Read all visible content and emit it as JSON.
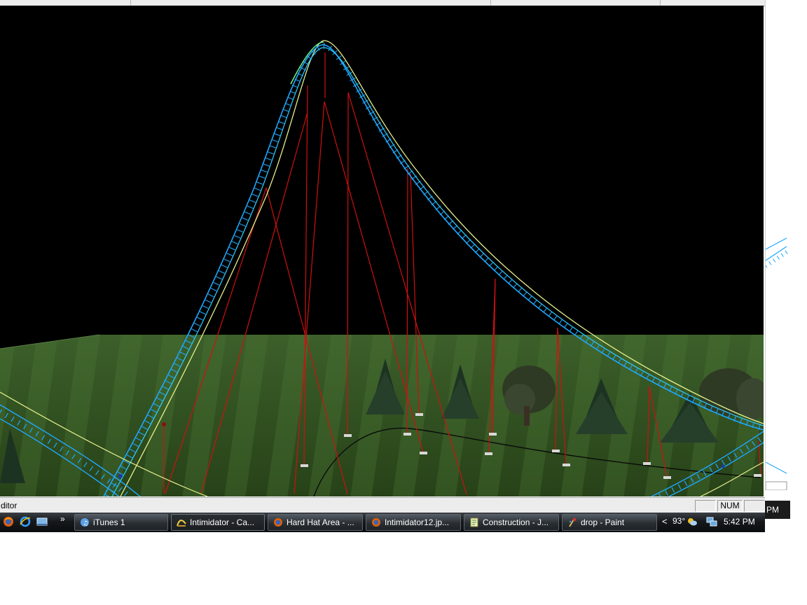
{
  "statusbar": {
    "text": "ditor",
    "num_indicator": "NUM",
    "cut_off_time_fragment": "PM"
  },
  "taskbar": {
    "overflow_chevron": "»",
    "buttons": [
      {
        "label": "iTunes 1",
        "icon": "itunes-icon",
        "active": false
      },
      {
        "label": "Intimidator - Ca...",
        "icon": "coaster-icon",
        "active": true
      },
      {
        "label": "Hard Hat Area - ...",
        "icon": "firefox-icon",
        "active": false
      },
      {
        "label": "Intimidator12.jp...",
        "icon": "firefox-icon",
        "active": false
      },
      {
        "label": "Construction - J...",
        "icon": "document-icon",
        "active": false
      },
      {
        "label": "drop - Paint",
        "icon": "paint-icon",
        "active": false
      }
    ],
    "quicklaunch": [
      "firefox-icon",
      "internet-explorer-icon",
      "show-desktop-icon"
    ],
    "tray": {
      "chevron": "<",
      "temperature": "93°",
      "weather_icon": "weather-icon",
      "network_icon": "network-icon",
      "clock": "5:42 PM"
    }
  },
  "scene": {
    "description_icon": "3d-viewport",
    "colors": {
      "sky": "#000000",
      "grass_dark": "#2c4a1c",
      "grass_light": "#4d7636",
      "track_cyan": "#1ea8ff",
      "track_yellow": "#e6f08c",
      "support_red": "#d01010",
      "tree": "#1e3322"
    }
  }
}
